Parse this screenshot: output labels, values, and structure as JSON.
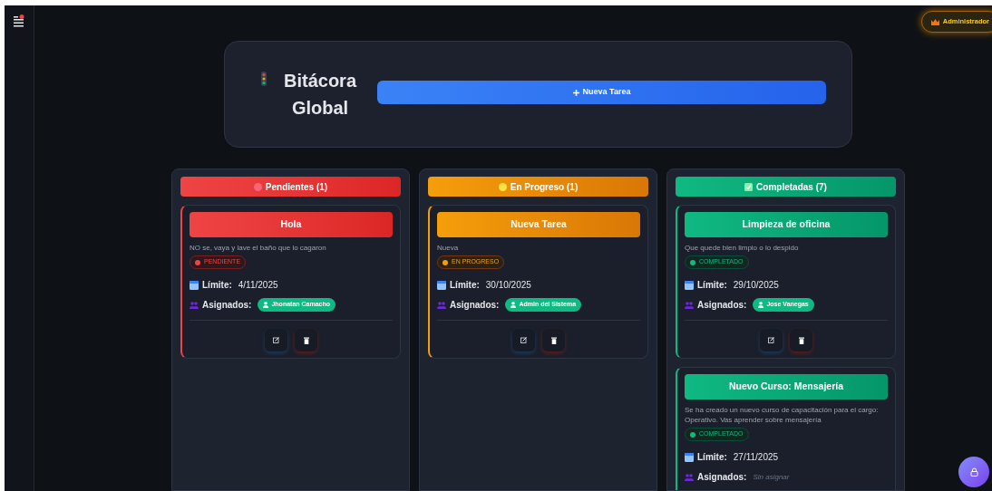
{
  "role_badge": "Administrador",
  "header": {
    "title": "Bitácora Global",
    "new_button": "Nueva Tarea"
  },
  "columns": [
    {
      "kind": "pending",
      "title": "Pendientes (1)",
      "tasks": [
        {
          "title": "Hola",
          "description": "NO se, vaya y lave el baño que lo cagaron",
          "status": "PENDIENTE",
          "limit_label": "Límite:",
          "date": "4/11/2025",
          "assigned_label": "Asignados:",
          "assignees": [
            "Jhonatan Camacho"
          ]
        }
      ]
    },
    {
      "kind": "progress",
      "title": "En Progreso (1)",
      "tasks": [
        {
          "title": "Nueva Tarea",
          "description": "Nueva",
          "status": "EN PROGRESO",
          "limit_label": "Límite:",
          "date": "30/10/2025",
          "assigned_label": "Asignados:",
          "assignees": [
            "Admin del Sistema"
          ]
        }
      ]
    },
    {
      "kind": "done",
      "title": "Completadas (7)",
      "tasks": [
        {
          "title": "Limpieza de oficina",
          "description": "Que quede bien limpio o lo despido",
          "status": "COMPLETADO",
          "limit_label": "Límite:",
          "date": "29/10/2025",
          "assigned_label": "Asignados:",
          "assignees": [
            "Jose Vanegas"
          ]
        },
        {
          "title": "Nuevo Curso: Mensajería",
          "description": "Se ha creado un nuevo curso de capacitación para el cargo: Operativo. Vas aprender sobre mensajería",
          "status": "COMPLETADO",
          "limit_label": "Límite:",
          "date": "27/11/2025",
          "assigned_label": "Asignados:",
          "unassigned": "Sin asignar"
        }
      ]
    }
  ]
}
